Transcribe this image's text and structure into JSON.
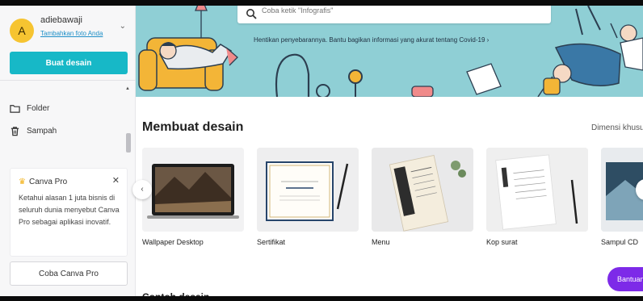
{
  "account": {
    "initial": "A",
    "name": "adiebawaji",
    "link": "Tambahkan foto Anda"
  },
  "sidebar": {
    "create_label": "Buat desain",
    "items": [
      {
        "label": "Folder",
        "icon": "folder-icon"
      },
      {
        "label": "Sampah",
        "icon": "trash-icon"
      }
    ]
  },
  "pro": {
    "title": "Canva Pro",
    "text": "Ketahui alasan 1 juta bisnis di seluruh dunia menyebut Canva Pro sebagai aplikasi inovatif.",
    "try_label": "Coba Canva Pro"
  },
  "hero": {
    "search_placeholder": "Coba ketik \"Infografis\"",
    "message": "Hentikan penyebarannya. Bantu bagikan informasi yang akurat tentang Covid-19 ›"
  },
  "main": {
    "section_title": "Membuat desain",
    "section_link": "Dimensi khusus",
    "next_title": "Contoh desain",
    "cards": [
      {
        "label": "Wallpaper Desktop"
      },
      {
        "label": "Sertifikat"
      },
      {
        "label": "Menu"
      },
      {
        "label": "Kop surat"
      },
      {
        "label": "Sampul CD"
      }
    ]
  },
  "help": {
    "label": "Bantuan"
  },
  "colors": {
    "accent": "#17b8c7",
    "hero_bg": "#8fcfd5",
    "help": "#7d2ae8",
    "avatar": "#f6c431"
  }
}
